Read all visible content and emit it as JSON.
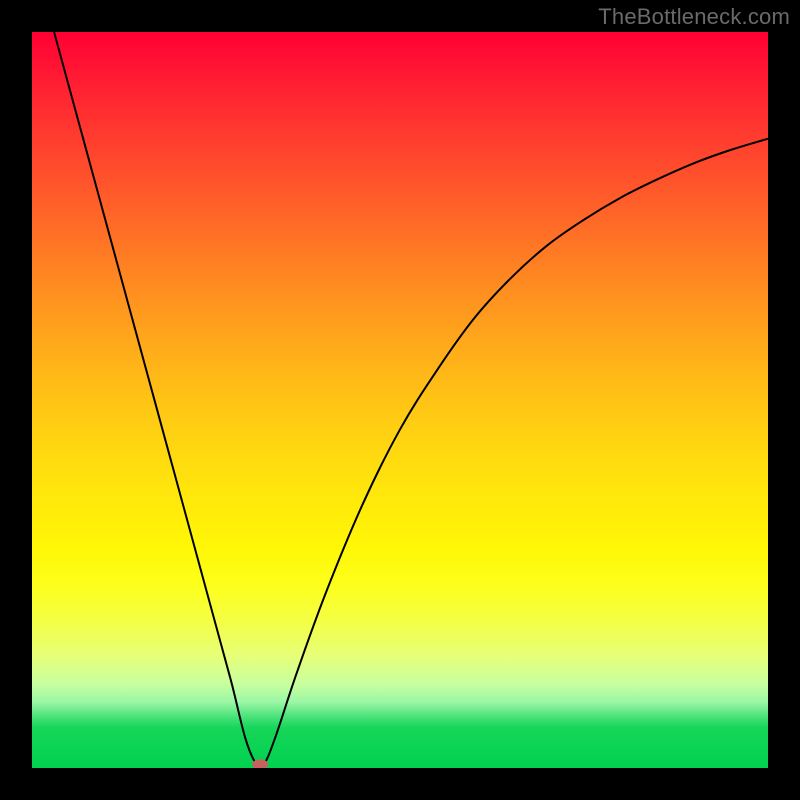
{
  "watermark": "TheBottleneck.com",
  "colors": {
    "frame": "#000000",
    "curve": "#000000",
    "marker": "#c86060"
  },
  "chart_data": {
    "type": "line",
    "title": "",
    "xlabel": "",
    "ylabel": "",
    "xlim": [
      0,
      100
    ],
    "ylim": [
      0,
      100
    ],
    "grid": false,
    "legend": false,
    "annotations": [],
    "series": [
      {
        "name": "curve",
        "x": [
          3,
          6,
          9,
          12,
          15,
          18,
          21,
          24,
          27,
          29,
          30.5,
          31.5,
          33,
          36,
          40,
          45,
          50,
          55,
          60,
          65,
          70,
          75,
          80,
          85,
          90,
          95,
          100
        ],
        "y": [
          100,
          89,
          78,
          67,
          56,
          45,
          34,
          23,
          12,
          4,
          0.5,
          0.5,
          4,
          13,
          24,
          36,
          46,
          54,
          61,
          66.5,
          71,
          74.5,
          77.5,
          80,
          82.2,
          84,
          85.5
        ]
      }
    ],
    "marker": {
      "x": 31,
      "y": 0.5
    },
    "background_gradient_stops": [
      {
        "pos": 0,
        "color": "#ff0033"
      },
      {
        "pos": 50,
        "color": "#ffd012"
      },
      {
        "pos": 75,
        "color": "#fdff1a"
      },
      {
        "pos": 94,
        "color": "#17d65a"
      },
      {
        "pos": 100,
        "color": "#00d14e"
      }
    ]
  }
}
